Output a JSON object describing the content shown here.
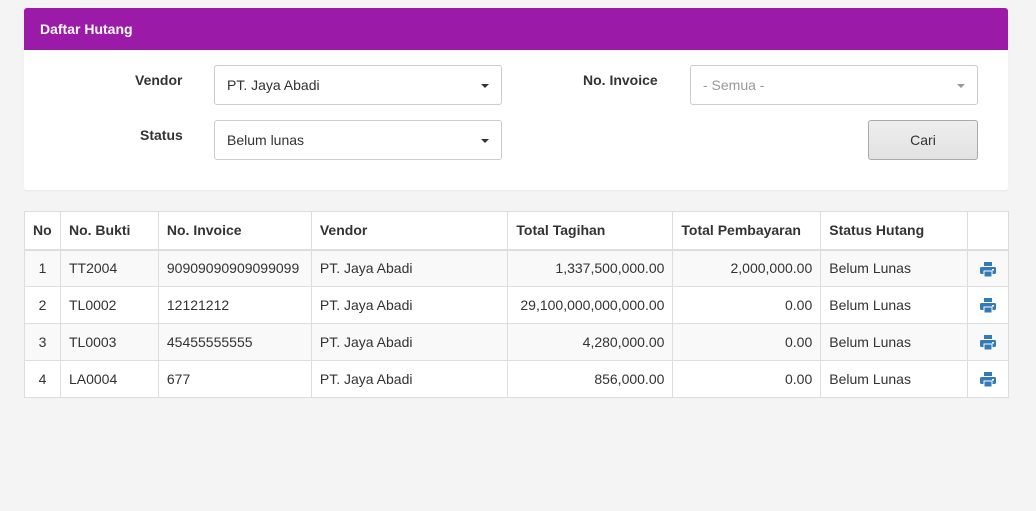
{
  "panel": {
    "title": "Daftar Hutang"
  },
  "form": {
    "vendor_label": "Vendor",
    "vendor_value": "PT. Jaya Abadi",
    "invoice_label": "No. Invoice",
    "invoice_value": "- Semua -",
    "status_label": "Status",
    "status_value": "Belum lunas",
    "search_button": "Cari"
  },
  "table": {
    "headers": [
      "No",
      "No. Bukti",
      "No. Invoice",
      "Vendor",
      "Total Tagihan",
      "Total Pembayaran",
      "Status Hutang",
      ""
    ],
    "rows": [
      {
        "no": "1",
        "bukti": "TT2004",
        "invoice": "90909090909099099",
        "vendor": "PT. Jaya Abadi",
        "tagihan": "1,337,500,000.00",
        "pembayaran": "2,000,000.00",
        "status": "Belum Lunas"
      },
      {
        "no": "2",
        "bukti": "TL0002",
        "invoice": "12121212",
        "vendor": "PT. Jaya Abadi",
        "tagihan": "29,100,000,000,000.00",
        "pembayaran": "0.00",
        "status": "Belum Lunas"
      },
      {
        "no": "3",
        "bukti": "TL0003",
        "invoice": "45455555555",
        "vendor": "PT. Jaya Abadi",
        "tagihan": "4,280,000.00",
        "pembayaran": "0.00",
        "status": "Belum Lunas"
      },
      {
        "no": "4",
        "bukti": "LA0004",
        "invoice": "677",
        "vendor": "PT. Jaya Abadi",
        "tagihan": "856,000.00",
        "pembayaran": "0.00",
        "status": "Belum Lunas"
      }
    ]
  },
  "icons": {
    "row_action": "print-icon"
  },
  "colors": {
    "header_bg": "#9c1aa8",
    "icon": "#337ab7"
  }
}
